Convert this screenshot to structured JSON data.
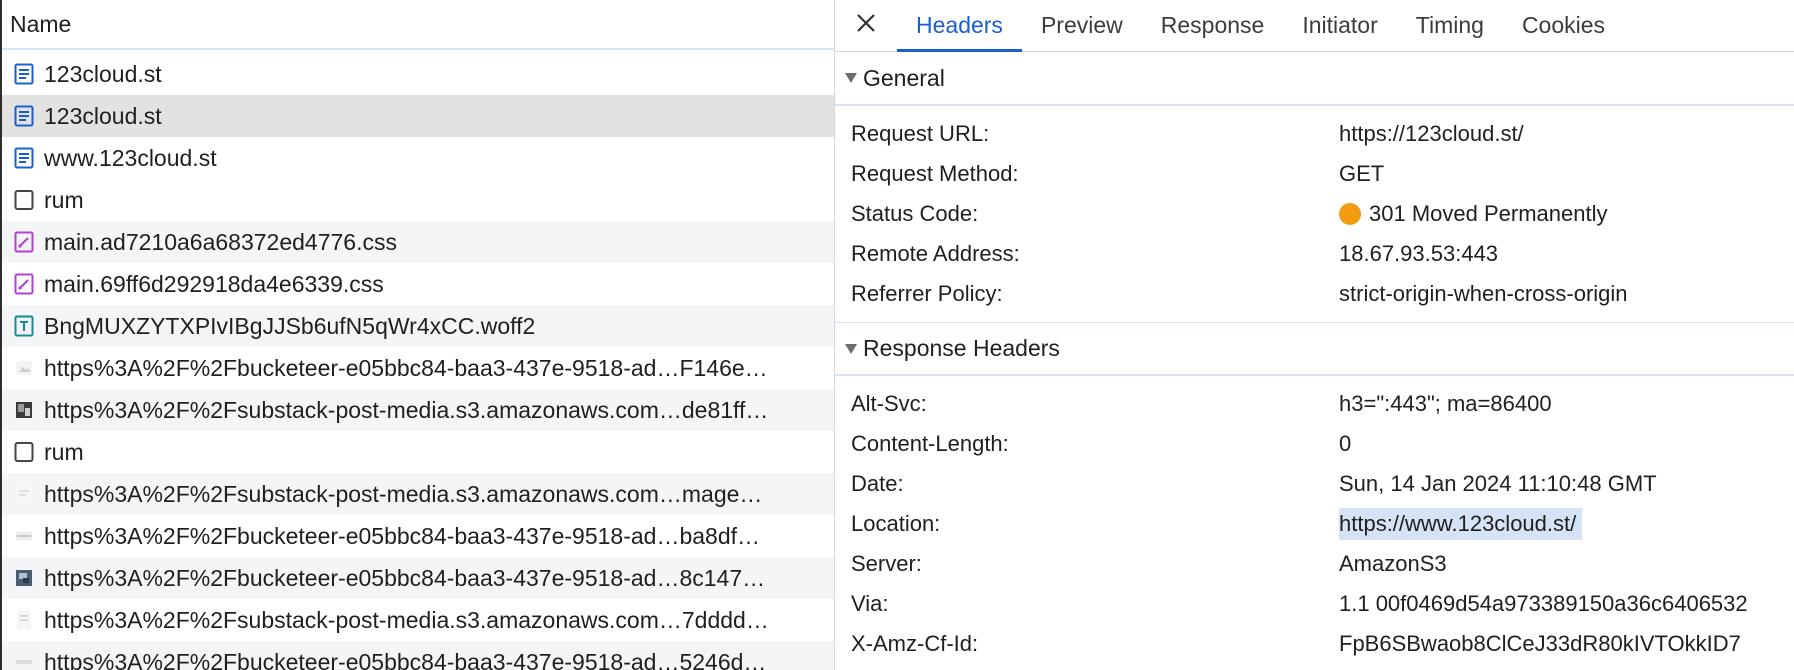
{
  "list": {
    "header": "Name",
    "rows": [
      {
        "label": "123cloud.st",
        "icon": "document-icon"
      },
      {
        "label": "123cloud.st",
        "icon": "document-icon"
      },
      {
        "label": "www.123cloud.st",
        "icon": "document-icon"
      },
      {
        "label": "rum",
        "icon": "blank-file-icon"
      },
      {
        "label": "main.ad7210a6a68372ed4776.css",
        "icon": "stylesheet-icon"
      },
      {
        "label": "main.69ff6d292918da4e6339.css",
        "icon": "stylesheet-icon"
      },
      {
        "label": "BngMUXZYTXPIvIBgJJSb6ufN5qWr4xCC.woff2",
        "icon": "font-icon"
      },
      {
        "label": "https%3A%2F%2Fbucketeer-e05bbc84-baa3-437e-9518-ad…F146e…",
        "icon": "image-thumbnail-icon"
      },
      {
        "label": "https%3A%2F%2Fsubstack-post-media.s3.amazonaws.com…de81ff…",
        "icon": "image-thumbnail-icon"
      },
      {
        "label": "rum",
        "icon": "blank-file-icon"
      },
      {
        "label": "https%3A%2F%2Fsubstack-post-media.s3.amazonaws.com…mage…",
        "icon": "image-thumbnail-icon"
      },
      {
        "label": "https%3A%2F%2Fbucketeer-e05bbc84-baa3-437e-9518-ad…ba8df…",
        "icon": "image-thumbnail-icon"
      },
      {
        "label": "https%3A%2F%2Fbucketeer-e05bbc84-baa3-437e-9518-ad…8c147…",
        "icon": "image-thumbnail-icon"
      },
      {
        "label": "https%3A%2F%2Fsubstack-post-media.s3.amazonaws.com…7dddd…",
        "icon": "image-thumbnail-icon"
      },
      {
        "label": "https%3A%2F%2Fbucketeer-e05bbc84-baa3-437e-9518-ad…5246d…",
        "icon": "image-thumbnail-icon"
      }
    ]
  },
  "tabs": {
    "close_icon": "close-icon",
    "items": [
      "Headers",
      "Preview",
      "Response",
      "Initiator",
      "Timing",
      "Cookies"
    ],
    "active": "Headers"
  },
  "general": {
    "title": "General",
    "rows": [
      {
        "key": "Request URL:",
        "value": "https://123cloud.st/"
      },
      {
        "key": "Request Method:",
        "value": "GET"
      },
      {
        "key": "Status Code:",
        "value": "301 Moved Permanently"
      },
      {
        "key": "Remote Address:",
        "value": "18.67.93.53:443"
      },
      {
        "key": "Referrer Policy:",
        "value": "strict-origin-when-cross-origin"
      }
    ]
  },
  "response_headers": {
    "title": "Response Headers",
    "rows": [
      {
        "key": "Alt-Svc:",
        "value": "h3=\":443\"; ma=86400"
      },
      {
        "key": "Content-Length:",
        "value": "0"
      },
      {
        "key": "Date:",
        "value": "Sun, 14 Jan 2024 11:10:48 GMT"
      },
      {
        "key": "Location:",
        "value": "https://www.123cloud.st/"
      },
      {
        "key": "Server:",
        "value": "AmazonS3"
      },
      {
        "key": "Via:",
        "value": "1.1 00f0469d54a973389150a36c6406532"
      },
      {
        "key": "X-Amz-Cf-Id:",
        "value": "FpB6SBwaob8ClCeJ33dR80kIVTOkkID7"
      }
    ]
  },
  "colors": {
    "accent": "#1a5fd0",
    "status_warning": "#f29d0f",
    "selected_row": "#e2e3e0",
    "highlight": "#d6e3f6"
  }
}
